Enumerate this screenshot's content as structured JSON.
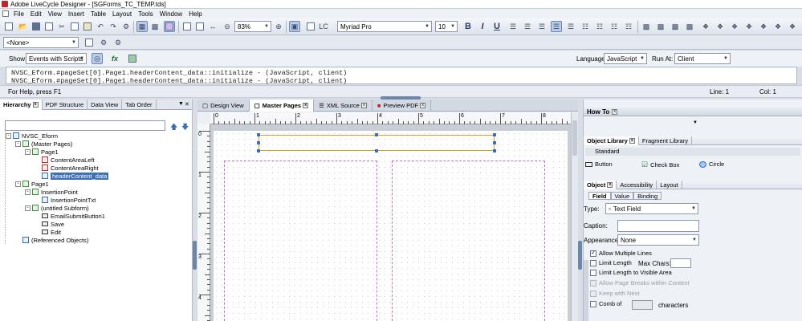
{
  "window": {
    "title": "Adobe LiveCycle Designer - [SGForms_TC_TEMP.tds]"
  },
  "menu": [
    "File",
    "Edit",
    "View",
    "Insert",
    "Table",
    "Layout",
    "Tools",
    "Window",
    "Help"
  ],
  "toolbar": {
    "zoom": "83%",
    "font": "Myriad Pro",
    "font_size": "10",
    "bold": "B",
    "italic": "I",
    "underline": "U",
    "master_select": "<None>"
  },
  "scriptbar": {
    "show_label": "Show:",
    "show_value": "Events with Scripts",
    "fx": "fx",
    "language_label": "Language:",
    "language_value": "JavaScript",
    "runat_label": "Run At:",
    "runat_value": "Client"
  },
  "script_lines": [
    "NVSC_Eform.#pageSet[0].Page1.headerContent_data::initialize - (JavaScript, client)",
    "NVSC_Eform.#pageSet[0].Page1.headerContent_data::initialize - (JavaScript, client)"
  ],
  "status": {
    "help": "For Help, press F1",
    "line": "Line: 1",
    "col": "Col: 1"
  },
  "left_tabs": [
    "Hierarchy",
    "PDF Structure",
    "Data View",
    "Tab Order"
  ],
  "tree": [
    {
      "label": "NVSC_Eform",
      "indent": 0,
      "exp": "-",
      "icon": "form"
    },
    {
      "label": "(Master Pages)",
      "indent": 1,
      "exp": "-",
      "icon": "pages"
    },
    {
      "label": "Page1",
      "indent": 2,
      "exp": "-",
      "icon": "page"
    },
    {
      "label": "ContentAreaLeft",
      "indent": 3,
      "exp": "",
      "icon": "content"
    },
    {
      "label": "ContentAreaRight",
      "indent": 3,
      "exp": "",
      "icon": "content"
    },
    {
      "label": "headerContent_data",
      "indent": 3,
      "exp": "",
      "icon": "field",
      "selected": true
    },
    {
      "label": "Page1",
      "indent": 1,
      "exp": "-",
      "icon": "page"
    },
    {
      "label": "InsertionPoint",
      "indent": 2,
      "exp": "-",
      "icon": "subform"
    },
    {
      "label": "InsertionPointTxt",
      "indent": 3,
      "exp": "",
      "icon": "text"
    },
    {
      "label": "(untitled Subform)",
      "indent": 2,
      "exp": "-",
      "icon": "subform"
    },
    {
      "label": "EmailSubmitButton1",
      "indent": 3,
      "exp": "",
      "icon": "button"
    },
    {
      "label": "Save",
      "indent": 3,
      "exp": "",
      "icon": "button"
    },
    {
      "label": "Edit",
      "indent": 3,
      "exp": "",
      "icon": "button"
    },
    {
      "label": "(Referenced Objects)",
      "indent": 1,
      "exp": "",
      "icon": "ref"
    }
  ],
  "doc_tabs": [
    "Design View",
    "Master Pages",
    "XML Source",
    "Preview PDF"
  ],
  "ruler_h": [
    "0",
    "1",
    "2",
    "3",
    "4",
    "5",
    "6",
    "7",
    "8"
  ],
  "ruler_v": [
    "0",
    "1",
    "2",
    "3",
    "4"
  ],
  "right": {
    "howto": "How To",
    "lib_tab": "Object Library",
    "frag_tab": "Fragment Library",
    "standard": "Standard",
    "items": [
      "Button",
      "Check Box",
      "Circle"
    ],
    "obj_tabs": [
      "Object",
      "Accessibility",
      "Layout"
    ],
    "sub_tabs": [
      "Field",
      "Value",
      "Binding"
    ],
    "type_label": "Type:",
    "type_value": "Text Field",
    "caption_label": "Caption:",
    "appearance_label": "Appearance:",
    "appearance_value": "None",
    "options": [
      {
        "label": "Allow Multiple Lines",
        "checked": true,
        "disabled": false
      },
      {
        "label": "Limit Length",
        "checked": false,
        "disabled": false
      },
      {
        "label": "Limit Length to Visible Area",
        "checked": false,
        "disabled": false
      },
      {
        "label": "Allow Page Breaks within Content",
        "checked": false,
        "disabled": true
      },
      {
        "label": "Keep with Next",
        "checked": false,
        "disabled": true
      },
      {
        "label": "Comb of",
        "checked": false,
        "disabled": false
      }
    ],
    "max_chars": "Max Chars:",
    "characters": "characters"
  },
  "colors": {
    "accent": "#3d6fb6",
    "selection_border": "#c9a227",
    "content_area": "#c86bd6"
  }
}
